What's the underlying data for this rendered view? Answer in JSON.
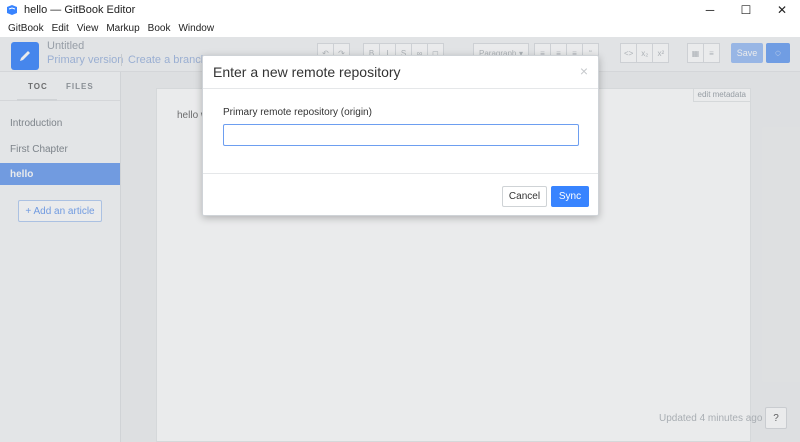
{
  "window": {
    "title": "hello — GitBook Editor",
    "controls": {
      "minimize": "─",
      "maximize": "☐",
      "close": "✕"
    }
  },
  "menu": [
    "GitBook",
    "Edit",
    "View",
    "Markup",
    "Book",
    "Window"
  ],
  "header": {
    "book_title": "Untitled",
    "branch": "Primary version",
    "create_branch": "Create a branch",
    "toolbar": {
      "undo": "↶",
      "redo": "↷",
      "bold": "B",
      "italic": "I",
      "strikethrough": "S",
      "link": "∞",
      "comment": "◻",
      "paragraph": "Paragraph",
      "paragraph_caret": "▾",
      "bullet_list": "≡",
      "numbered_list": "≡",
      "task_list": "≡",
      "quote": "“",
      "code": "<>",
      "subscript": "x₂",
      "superscript": "x²",
      "table": "▦",
      "align": "≡"
    },
    "save": "Save",
    "sync_icon": "◌"
  },
  "sidebar": {
    "tabs": [
      "TOC",
      "FILES"
    ],
    "items": [
      {
        "label": "Introduction",
        "active": false
      },
      {
        "label": "First Chapter",
        "active": false
      },
      {
        "label": "hello",
        "active": true
      }
    ],
    "add_article": "+ Add an article"
  },
  "editor": {
    "edit_metadata": "edit metadata",
    "text": "hello w",
    "status": "Updated 4 minutes ago",
    "help": "?"
  },
  "modal": {
    "title": "Enter a new remote repository",
    "close": "×",
    "field_label": "Primary remote repository (origin)",
    "field_value": "",
    "field_placeholder": "",
    "cancel": "Cancel",
    "sync": "Sync"
  },
  "colors": {
    "accent": "#3884ff",
    "active_item": "#6c9ef1"
  }
}
